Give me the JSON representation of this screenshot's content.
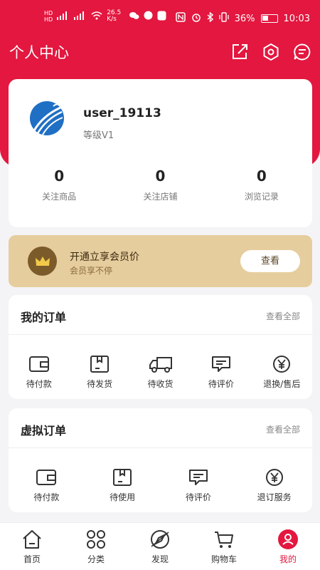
{
  "status": {
    "left": "26.5 K/s",
    "battery": "36%",
    "time": "10:03"
  },
  "header": {
    "title": "个人中心"
  },
  "profile": {
    "username": "user_19113",
    "level": "等级V1",
    "stats": [
      {
        "value": "0",
        "label": "关注商品"
      },
      {
        "value": "0",
        "label": "关注店铺"
      },
      {
        "value": "0",
        "label": "浏览记录"
      }
    ]
  },
  "vip": {
    "title": "开通立享会员价",
    "subtitle": "会员享不停",
    "button": "查看"
  },
  "orders": {
    "title": "我的订单",
    "view_all": "查看全部",
    "items": [
      "待付款",
      "待发货",
      "待收货",
      "待评价",
      "退换/售后"
    ]
  },
  "virtual_orders": {
    "title": "虚拟订单",
    "view_all": "查看全部",
    "items": [
      "待付款",
      "待使用",
      "待评价",
      "退订服务"
    ]
  },
  "tabs": [
    {
      "label": "首页"
    },
    {
      "label": "分类"
    },
    {
      "label": "发现"
    },
    {
      "label": "购物车"
    },
    {
      "label": "我的"
    }
  ],
  "colors": {
    "accent": "#e3173f",
    "vip_bg": "#e6cd9e"
  }
}
